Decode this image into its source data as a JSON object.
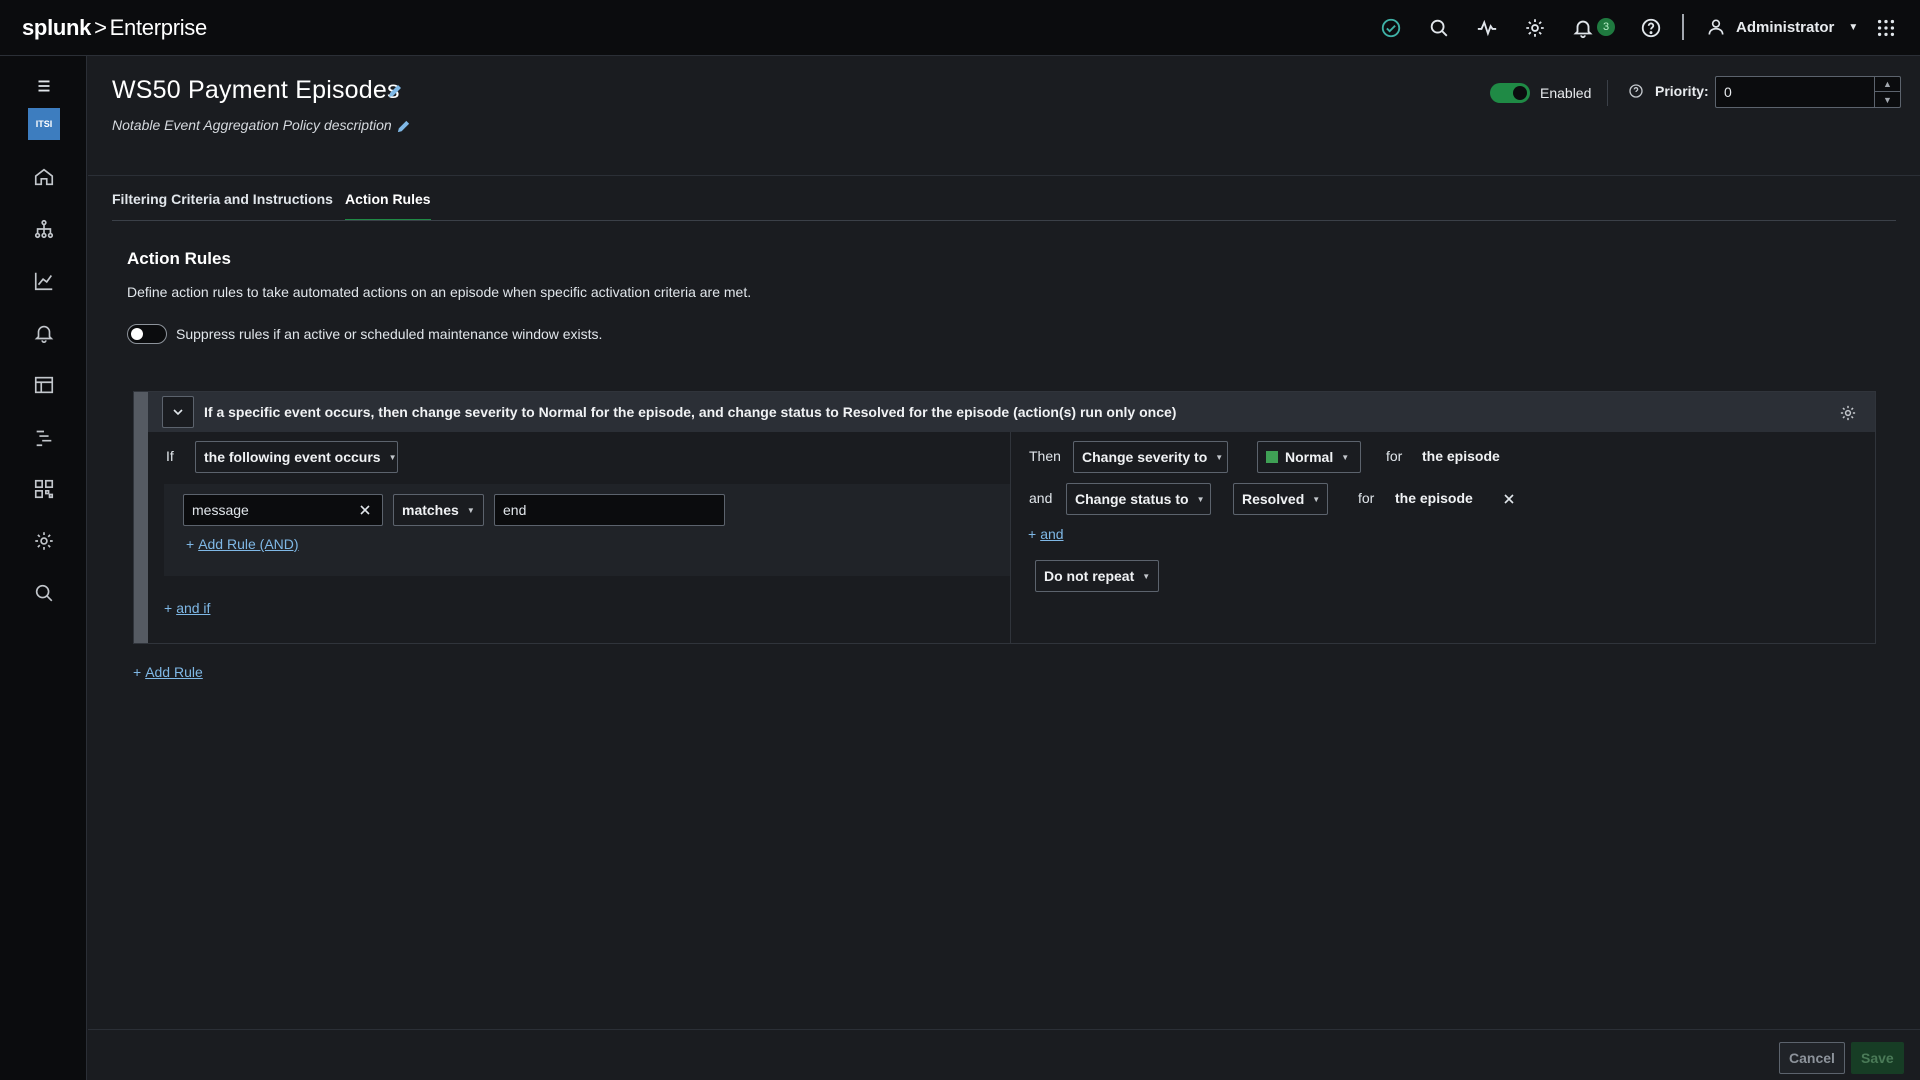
{
  "app": {
    "brand": "splunk",
    "arrow": ">",
    "product": "Enterprise"
  },
  "topbar": {
    "notifications_count": "3",
    "user_name": "Administrator"
  },
  "sidebar": {
    "app_badge": "ITSI"
  },
  "page": {
    "title": "WS50 Payment Episodes",
    "description": "Notable Event Aggregation Policy description",
    "enabled_label": "Enabled",
    "priority_label": "Priority:",
    "priority_value": "0"
  },
  "tabs": [
    {
      "label": "Filtering Criteria and Instructions"
    },
    {
      "label": "Action Rules"
    }
  ],
  "section": {
    "title": "Action Rules",
    "description": "Define action rules to take automated actions on an episode when specific activation criteria are met.",
    "suppress_label": "Suppress rules if an active or scheduled maintenance window exists."
  },
  "rule": {
    "summary": "If a specific event occurs, then change severity to Normal for the episode, and change status to Resolved for the episode (action(s) run only once)",
    "if_label": "If",
    "condition_select": "the following event occurs",
    "field_value": "message",
    "operator": "matches",
    "match_value": "end",
    "add_rule_and": "Add Rule (AND)",
    "and_if": "and if",
    "then_label": "Then",
    "action1_select": "Change severity to",
    "severity_value": "Normal",
    "for_label": "for",
    "target1": "the episode",
    "and_label": "and",
    "action2_select": "Change status to",
    "status_value": "Resolved",
    "target2": "the episode",
    "add_and": "and",
    "repeat_select": "Do not repeat"
  },
  "add_rule": "Add Rule",
  "footer": {
    "cancel": "Cancel",
    "save": "Save"
  },
  "colors": {
    "accent": "#1f8a45",
    "severity_normal": "#3fa055",
    "link": "#7fb8e6"
  }
}
